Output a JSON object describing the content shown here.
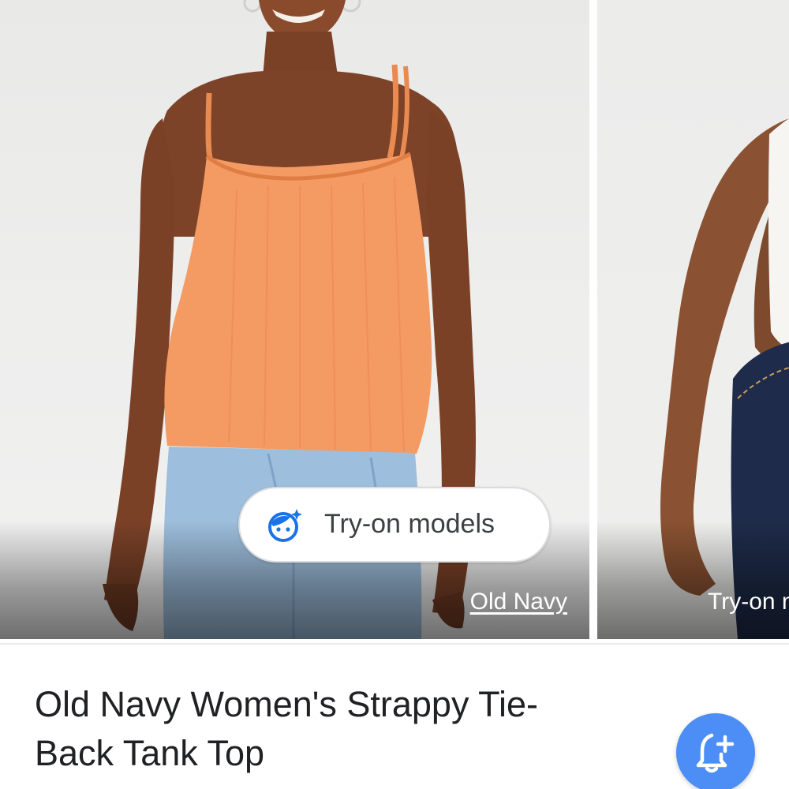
{
  "carousel": {
    "items": [
      {
        "image_label": "Woman wearing orange strappy tank top with light blue jeans",
        "source_link": "Old Navy",
        "tryon_chip_label": "Try-on models"
      },
      {
        "image_label": "Model wearing white tank top with dark jeans",
        "tryon_label_partial": "Try-on m"
      }
    ]
  },
  "product": {
    "title": "Old Navy Women's Strappy Tie-Back Tank Top"
  },
  "icons": {
    "tryon": "face-sparkle-icon",
    "alert": "bell-plus-icon"
  },
  "colors": {
    "accent": "#1a73e8",
    "fab": "#4c8df6",
    "tank_top": "#f39b63",
    "jeans_light": "#9dbedc",
    "jeans_dark": "#1e2b4a"
  }
}
